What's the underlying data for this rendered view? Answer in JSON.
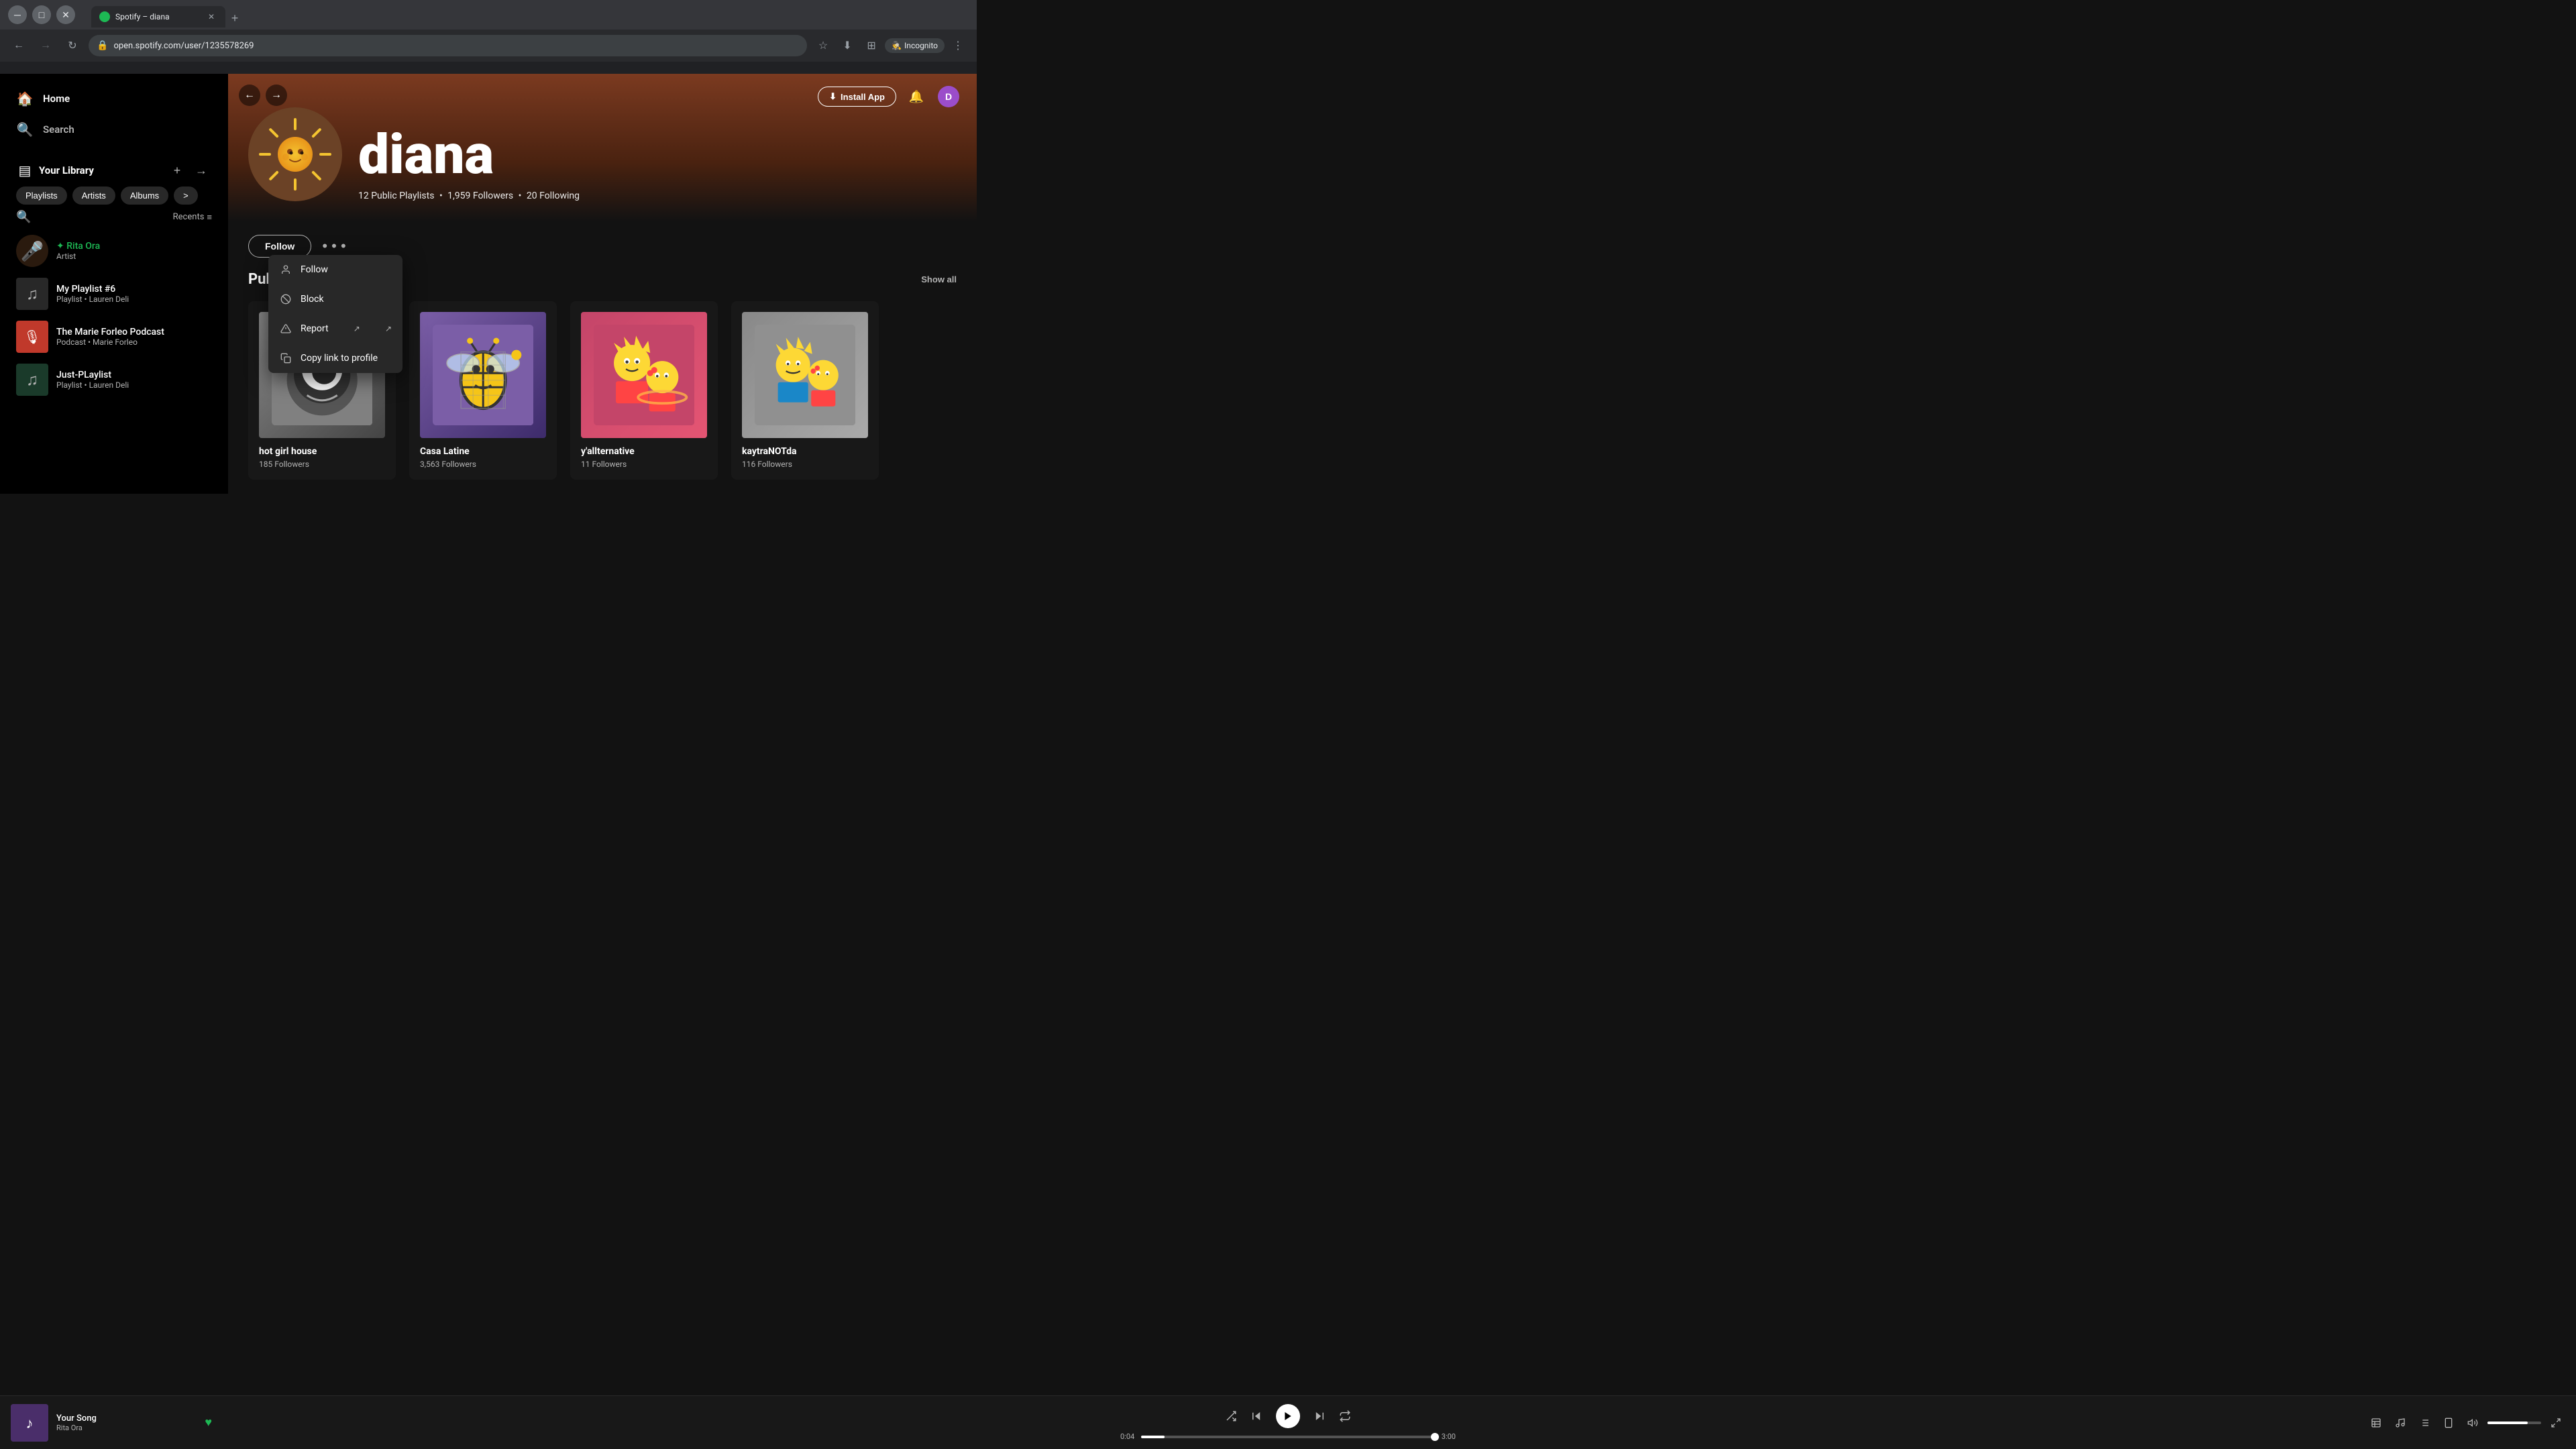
{
  "browser": {
    "tab_title": "Spotify – diana",
    "tab_favicon_color": "#1DB954",
    "url": "open.spotify.com/user/1235578269",
    "back_btn": "←",
    "forward_btn": "→",
    "reload_btn": "↻",
    "star_icon": "☆",
    "download_icon": "⬇",
    "split_icon": "⊞",
    "incognito_label": "Incognito",
    "more_icon": "⋮",
    "new_tab_icon": "+"
  },
  "sidebar": {
    "home_label": "Home",
    "search_label": "Search",
    "library_label": "Your Library",
    "library_add_icon": "+",
    "library_expand_icon": "→",
    "filter_playlists": "Playlists",
    "filter_artists": "Artists",
    "filter_albums": "Albums",
    "filter_more": ">",
    "search_icon": "🔍",
    "recents_label": "Recents",
    "list_icon": "≡",
    "items": [
      {
        "name": "Rita Ora",
        "meta": "Artist",
        "color": "#1DB954",
        "type": "artist",
        "bg": "#2A1A0E"
      },
      {
        "name": "My Playlist #6",
        "meta": "Playlist • Lauren Deli",
        "color": "#fff",
        "type": "playlist",
        "bg": "#282828"
      },
      {
        "name": "The Marie Forleo Podcast",
        "meta": "Podcast • Marie Forleo",
        "color": "#fff",
        "type": "podcast",
        "bg": "#C0392B"
      },
      {
        "name": "Just-PLaylist",
        "meta": "Playlist • Lauren Deli",
        "color": "#fff",
        "type": "playlist",
        "bg": "#1A3A2A"
      }
    ]
  },
  "profile": {
    "name": "diana",
    "public_playlists": "12 Public Playlists",
    "followers": "1,959 Followers",
    "following": "20 Following",
    "stats_separator": "•",
    "follow_btn": "Follow",
    "more_btn": "...",
    "section_title": "Public Playlists",
    "show_all": "Show all"
  },
  "context_menu": {
    "visible": true,
    "items": [
      {
        "id": "follow",
        "label": "Follow",
        "icon": "👤"
      },
      {
        "id": "block",
        "label": "Block",
        "icon": "🚫"
      },
      {
        "id": "report",
        "label": "Report",
        "icon": "⚑",
        "has_arrow": true
      },
      {
        "id": "copy_link",
        "label": "Copy link to profile",
        "icon": "📋"
      }
    ]
  },
  "playlists": [
    {
      "name": "hot girl house",
      "followers": "185 Followers",
      "bg1": "#888",
      "bg2": "#444"
    },
    {
      "name": "Casa Latine",
      "followers": "3,563 Followers",
      "bg1": "#7B5EA7",
      "bg2": "#3D2B6B"
    },
    {
      "name": "y'allternative",
      "followers": "11 Followers",
      "bg1": "#C44569",
      "bg2": "#E55573"
    },
    {
      "name": "kaytraNOTda",
      "followers": "116 Followers",
      "bg1": "#F7DC6F",
      "bg2": "#F0D060"
    }
  ],
  "player": {
    "song_name": "Your Song",
    "artist": "Rita Ora",
    "time_current": "0:04",
    "time_total": "3:00",
    "progress_pct": "8%",
    "volume_pct": "75%",
    "shuffle_icon": "⇄",
    "prev_icon": "⏮",
    "play_icon": "▶",
    "next_icon": "⏭",
    "repeat_icon": "↺",
    "queue_icon": "☰",
    "lyrics_icon": "♪",
    "now_playing_icon": "▤",
    "connect_icon": "📱",
    "volume_icon": "🔊",
    "fullscreen_icon": "⛶"
  },
  "topbar": {
    "install_app_label": "Install App",
    "install_icon": "⬇",
    "bell_icon": "🔔"
  }
}
